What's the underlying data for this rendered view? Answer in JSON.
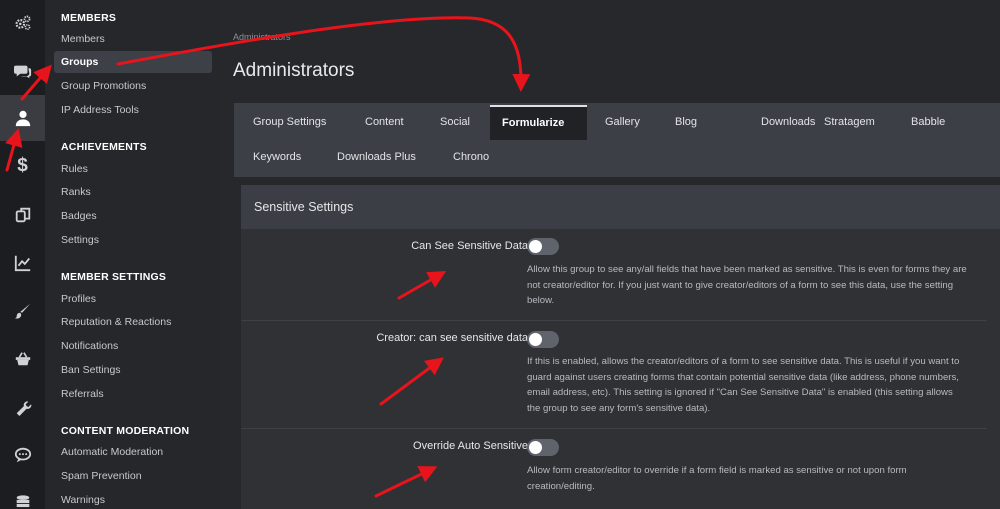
{
  "rail": {
    "items": [
      {
        "icon": "cogs-icon",
        "active": false
      },
      {
        "icon": "chat-icon",
        "active": false
      },
      {
        "icon": "user-icon",
        "active": true
      },
      {
        "icon": "dollar-icon",
        "active": false
      },
      {
        "icon": "copy-icon",
        "active": false
      },
      {
        "icon": "chart-icon",
        "active": false
      },
      {
        "icon": "brush-icon",
        "active": false
      },
      {
        "icon": "basket-icon",
        "active": false
      },
      {
        "icon": "wrench-icon",
        "active": false
      },
      {
        "icon": "comment-icon",
        "active": false
      },
      {
        "icon": "database-icon",
        "active": false
      }
    ]
  },
  "menu": {
    "members": {
      "heading": "MEMBERS",
      "items": [
        "Members",
        "Groups",
        "Group Promotions",
        "IP Address Tools"
      ],
      "active": "Groups"
    },
    "achievements": {
      "heading": "ACHIEVEMENTS",
      "items": [
        "Rules",
        "Ranks",
        "Badges",
        "Settings"
      ]
    },
    "member_settings": {
      "heading": "MEMBER SETTINGS",
      "items": [
        "Profiles",
        "Reputation & Reactions",
        "Notifications",
        "Ban Settings",
        "Referrals"
      ]
    },
    "content_moderation": {
      "heading": "CONTENT MODERATION",
      "items": [
        "Automatic Moderation",
        "Spam Prevention",
        "Warnings"
      ]
    }
  },
  "page": {
    "breadcrumb": "Administrators",
    "title": "Administrators"
  },
  "tabs": {
    "row1": [
      "Group Settings",
      "Content",
      "Social",
      "Formularize",
      "Gallery",
      "Blog",
      "Downloads",
      "Stratagem",
      "Babble"
    ],
    "row2": [
      "Keywords",
      "Downloads Plus",
      "Chrono"
    ],
    "active": "Formularize"
  },
  "section": {
    "heading": "Sensitive Settings",
    "settings": [
      {
        "label": "Can See Sensitive Data",
        "enabled": false,
        "description": "Allow this group to see any/all fields that have been marked as sensitive. This is even for forms they are not creator/editor for. If you just want to give creator/editors of a form to see this data, use the setting below."
      },
      {
        "label": "Creator: can see sensitive data",
        "enabled": false,
        "description": "If this is enabled, allows the creator/editors of a form to see sensitive data. This is useful if you want to guard against users creating forms that contain potential sensitive data (like address, phone numbers, email address, etc). This setting is ignored if \"Can See Sensitive Data\" is enabled (this setting allows the group to see any form's sensitive data)."
      },
      {
        "label": "Override Auto Sensitive",
        "enabled": false,
        "description": "Allow form creator/editor to override if a form field is marked as sensitive or not upon form creation/editing."
      }
    ]
  },
  "colors": {
    "annotation_arrow": "#e8141b",
    "toggle_off": "#5f636b",
    "active_tab_bg": "#212226"
  }
}
